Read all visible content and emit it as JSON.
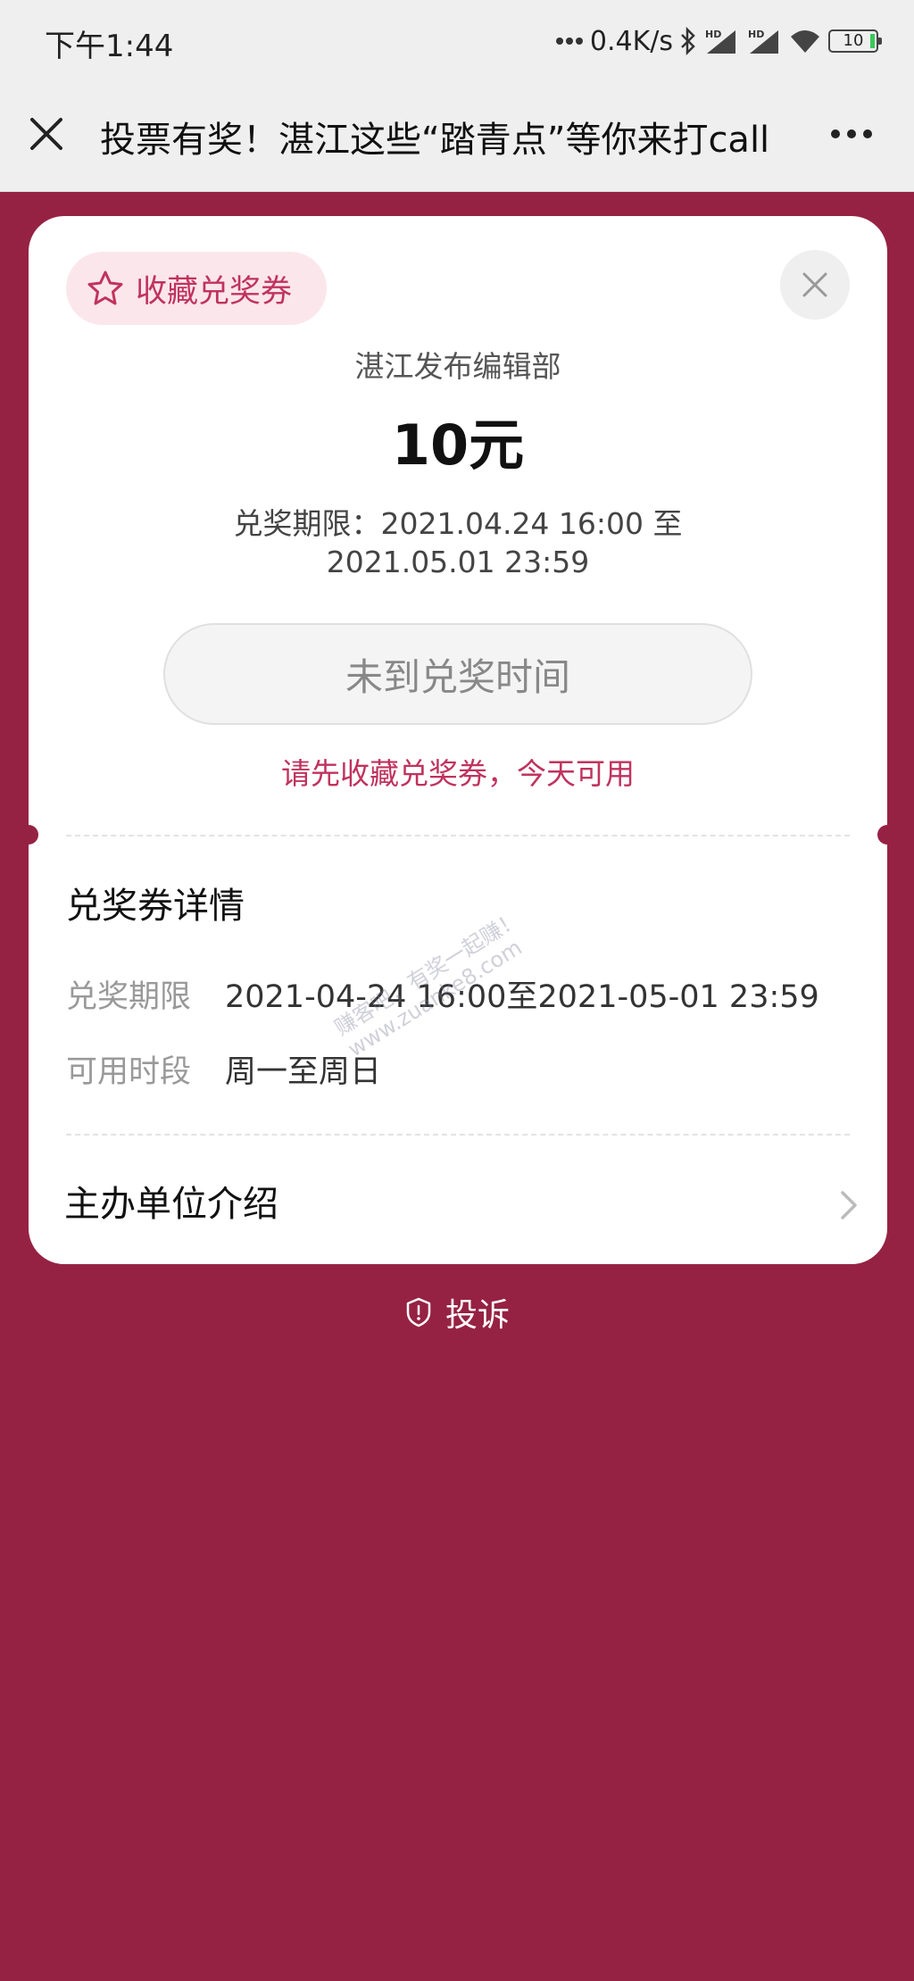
{
  "status_bar": {
    "time": "下午1:44",
    "network_speed": "0.4K/s",
    "battery": "10",
    "icons": [
      "dots-icon",
      "bluetooth-icon",
      "signal-hd-icon",
      "signal-hd-icon",
      "wifi-icon",
      "battery-icon"
    ]
  },
  "nav": {
    "title": "投票有奖！湛江这些“踏青点”等你来打call",
    "close_icon": "close-icon",
    "more_icon": "more-icon"
  },
  "coupon": {
    "favorite_label": "收藏兑奖券",
    "issuer": "湛江发布编辑部",
    "amount": "10元",
    "period_line1": "兑奖期限：2021.04.24 16:00 至",
    "period_line2": "2021.05.01 23:59",
    "redeem_button": "未到兑奖时间",
    "hint": "请先收藏兑奖券，今天可用"
  },
  "details": {
    "title": "兑奖券详情",
    "period_label": "兑奖期限",
    "period_value": "2021-04-24 16:00至2021-05-01 23:59",
    "hours_label": "可用时段",
    "hours_value": "周一至周日"
  },
  "organizer": {
    "label": "主办单位介绍"
  },
  "footer": {
    "complaint": "投诉"
  },
  "watermark": {
    "line1": "赚客吧，有奖一起赚！",
    "line2": "www.zuanke8.com"
  },
  "colors": {
    "background": "#962243",
    "accent": "#c0335e",
    "favorite_bg": "#fbe6ec"
  }
}
